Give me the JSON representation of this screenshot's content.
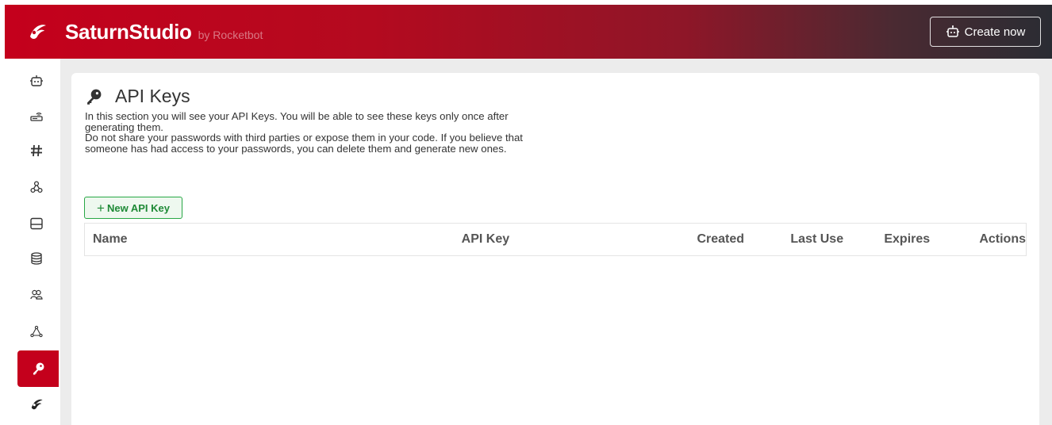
{
  "header": {
    "brand_name": "SaturnStudio",
    "brand_by": "by Rocketbot",
    "create_button": "Create now"
  },
  "sidebar": {
    "items": [
      {
        "icon": "robot-icon"
      },
      {
        "icon": "router-icon"
      },
      {
        "icon": "hash-icon"
      },
      {
        "icon": "webhook-icon"
      },
      {
        "icon": "layout-icon"
      },
      {
        "icon": "database-icon"
      },
      {
        "icon": "users-icon"
      },
      {
        "icon": "network-icon"
      },
      {
        "icon": "key-icon",
        "active": true
      },
      {
        "icon": "saturn-logo-icon"
      }
    ]
  },
  "page": {
    "title": "API Keys",
    "description_1": "In this section you will see your API Keys. You will be able to see these keys only once after generating them.",
    "description_2": "Do not share your passwords with third parties or expose them in your code. If you believe that someone has had access to your passwords, you can delete them and generate new ones.",
    "new_key_plus": "+",
    "new_key_label": "New API Key"
  },
  "table": {
    "columns": [
      "Name",
      "API Key",
      "Created",
      "Last Use",
      "Expires",
      "Actions"
    ],
    "rows": []
  },
  "colors": {
    "brand_red": "#c4001c",
    "header_dark": "#2a2c33",
    "success_green": "#28a745"
  }
}
